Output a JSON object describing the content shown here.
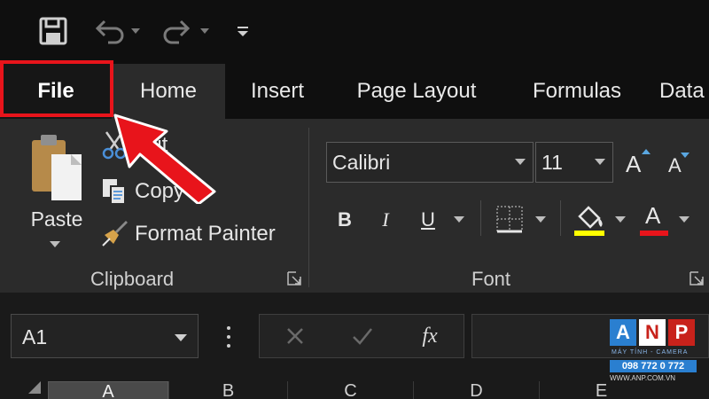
{
  "tabs": {
    "file": "File",
    "home": "Home",
    "insert": "Insert",
    "page_layout": "Page Layout",
    "formulas": "Formulas",
    "data": "Data"
  },
  "clipboard": {
    "paste": "Paste",
    "cut": "Cut",
    "copy": "Copy",
    "format_painter": "Format Painter",
    "group_label": "Clipboard"
  },
  "font": {
    "name": "Calibri",
    "size": "11",
    "grow_label": "A",
    "shrink_label": "A",
    "bold": "B",
    "italic": "I",
    "underline": "U",
    "font_color_label": "A",
    "group_label": "Font"
  },
  "formula_bar": {
    "name_box": "A1",
    "fx": "fx"
  },
  "columns": [
    "A",
    "B",
    "C",
    "D",
    "E"
  ],
  "watermark": {
    "letters": [
      "A",
      "N",
      "P"
    ],
    "sub": "MÁY TÍNH - CAMERA",
    "phone": "098 772 0 772",
    "url": "WWW.ANP.COM.VN"
  },
  "colors": {
    "highlight": "#e8141b",
    "fill_bar": "#ffff00",
    "font_color_bar": "#e8141b",
    "ribbon_bg": "#2b2b2b"
  },
  "icons": {
    "save": "save-icon",
    "undo": "undo-icon",
    "redo": "redo-icon",
    "customize": "customize-qat-icon",
    "paste": "paste-icon",
    "cut": "scissors-icon",
    "copy": "copy-icon",
    "format_painter": "paintbrush-icon",
    "borders": "borders-icon",
    "fill": "paint-bucket-icon",
    "cancel": "cancel-icon",
    "enter": "check-icon"
  }
}
